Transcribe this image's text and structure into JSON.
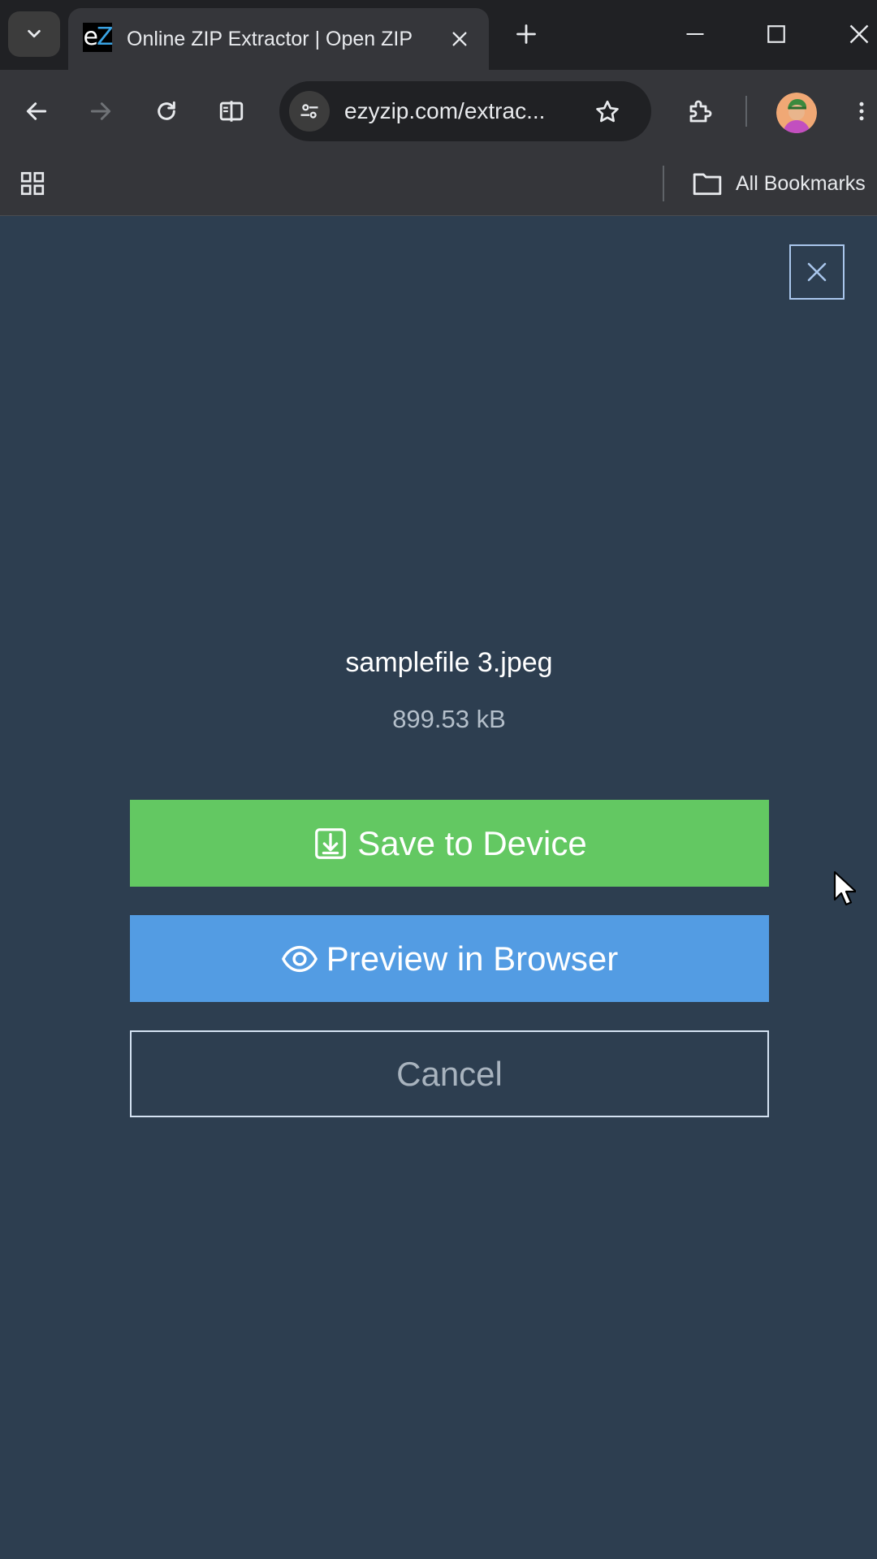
{
  "browser": {
    "tab": {
      "favicon_letters": [
        "e",
        "Z"
      ],
      "title": "Online ZIP Extractor | Open ZIP"
    },
    "address_bar": {
      "url": "ezyzip.com/extrac..."
    },
    "bookmarks_bar": {
      "all_bookmarks_label": "All Bookmarks"
    },
    "icons": {
      "tab_search": "chevron-down-icon",
      "tab_close": "close-icon",
      "new_tab": "plus-icon",
      "minimize": "minimize-icon",
      "maximize": "maximize-icon",
      "close_window": "close-icon",
      "back": "arrow-left-icon",
      "forward": "arrow-right-icon",
      "reload": "reload-icon",
      "split_view": "split-view-icon",
      "site_info": "tune-icon",
      "bookmark": "star-icon",
      "extensions": "puzzle-icon",
      "menu": "more-vertical-icon",
      "apps": "apps-grid-icon",
      "folder": "folder-icon"
    }
  },
  "modal": {
    "file_name": "samplefile 3.jpeg",
    "file_size": "899.53 kB",
    "buttons": {
      "save": "Save to Device",
      "preview": "Preview in Browser",
      "cancel": "Cancel"
    },
    "colors": {
      "background": "#2d3e50",
      "save": "#63c862",
      "preview": "#539ce3",
      "cancel_border": "#d4e2f2"
    }
  }
}
